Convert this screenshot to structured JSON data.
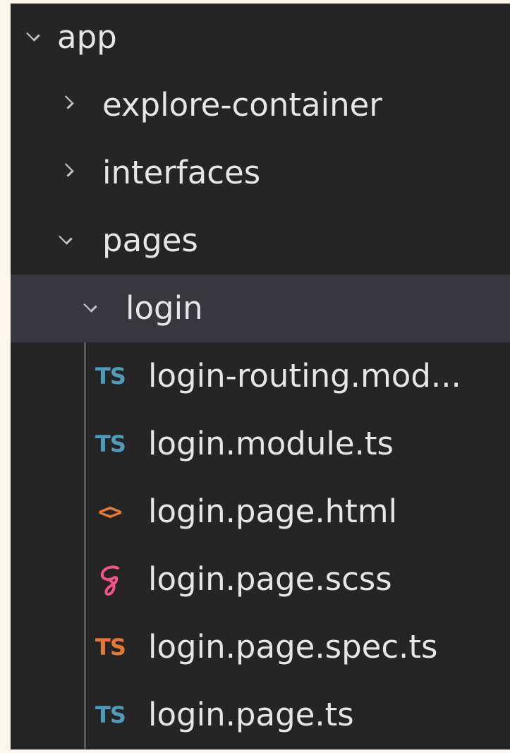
{
  "explorer": {
    "colors": {
      "panel_bg": "#252526",
      "selected_row_bg": "#37373d",
      "text": "#e6e6e6",
      "ts_icon": "#519aba",
      "ts_spec_icon": "#e37933",
      "html_icon": "#e37933",
      "scss_icon": "#f55385"
    },
    "folders": {
      "app": {
        "label": "app",
        "expanded": true,
        "icon": "chevron-down-icon"
      },
      "explore_container": {
        "label": "explore-container",
        "expanded": false,
        "icon": "chevron-right-icon"
      },
      "interfaces": {
        "label": "interfaces",
        "expanded": false,
        "icon": "chevron-right-icon"
      },
      "pages": {
        "label": "pages",
        "expanded": true,
        "icon": "chevron-down-icon"
      },
      "login": {
        "label": "login",
        "expanded": true,
        "selected": true,
        "icon": "chevron-down-icon"
      }
    },
    "files": [
      {
        "label": "login-routing.mod...",
        "icon_text": "TS",
        "icon": "typescript-file-icon"
      },
      {
        "label": "login.module.ts",
        "icon_text": "TS",
        "icon": "typescript-file-icon"
      },
      {
        "label": "login.page.html",
        "icon_text": "<>",
        "icon": "html-file-icon"
      },
      {
        "label": "login.page.scss",
        "icon_text": "",
        "icon": "sass-file-icon"
      },
      {
        "label": "login.page.spec.ts",
        "icon_text": "TS",
        "icon": "typescript-test-file-icon"
      },
      {
        "label": "login.page.ts",
        "icon_text": "TS",
        "icon": "typescript-file-icon"
      }
    ]
  }
}
